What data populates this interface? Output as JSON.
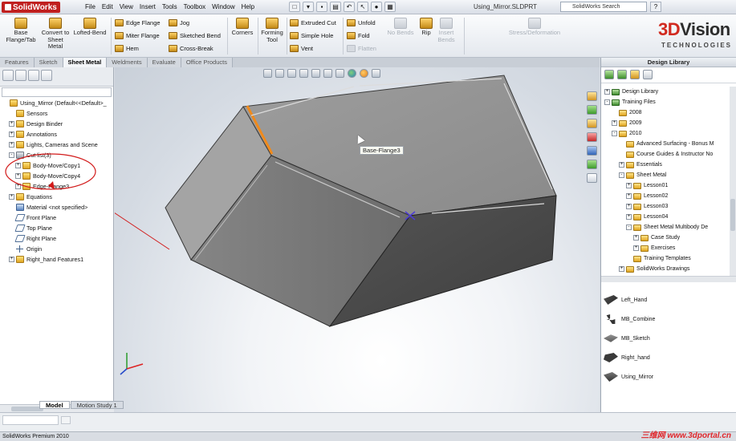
{
  "app": {
    "logo_text": "SolidWorks",
    "document_title": "Using_Mirror.SLDPRT"
  },
  "menu": [
    "File",
    "Edit",
    "View",
    "Insert",
    "Tools",
    "Toolbox",
    "Window",
    "Help"
  ],
  "search": {
    "value": "SolidWorks Search"
  },
  "help_button": "?",
  "ribbon": {
    "base_flange": "Base Flange/Tab",
    "convert": "Convert to Sheet Metal",
    "lofted_bend": "Lofted-Bend",
    "edge_flange": "Edge Flange",
    "miter_flange": "Miter Flange",
    "hem": "Hem",
    "jog": "Jog",
    "sketched_bend": "Sketched Bend",
    "cross_break": "Cross-Break",
    "corners": "Corners",
    "forming_tool": "Forming Tool",
    "extruded_cut": "Extruded Cut",
    "simple_hole": "Simple Hole",
    "vent": "Vent",
    "unfold": "Unfold",
    "fold": "Fold",
    "flatten": "Flatten",
    "no_bends": "No Bends",
    "rip": "Rip",
    "insert_bends": "Insert Bends",
    "shell_deformation": "Stress/Deformation"
  },
  "brand": {
    "main_1": "3D",
    "main_2": "Vision",
    "sub": "TECHNOLOGIES"
  },
  "tabs": [
    "Features",
    "Sketch",
    "Sheet Metal",
    "Weldments",
    "Evaluate",
    "Office Products"
  ],
  "active_tab": "Sheet Metal",
  "feature_tree": [
    {
      "label": "Using_Mirror  (Default<<Default>_",
      "indent": 0,
      "icon": "part-icon",
      "exp": ""
    },
    {
      "label": "Sensors",
      "indent": 1,
      "icon": "sensors-icon",
      "exp": ""
    },
    {
      "label": "Design Binder",
      "indent": 1,
      "icon": "design-binder-icon",
      "exp": "+"
    },
    {
      "label": "Annotations",
      "indent": 1,
      "icon": "annotations-icon",
      "exp": "+"
    },
    {
      "label": "Lights, Cameras and Scene",
      "indent": 1,
      "icon": "lights-icon",
      "exp": "+"
    },
    {
      "label": "Cut list(3)",
      "indent": 1,
      "icon": "cut-list-icon",
      "exp": "-"
    },
    {
      "label": "Body-Move/Copy1",
      "indent": 2,
      "icon": "sheet-body-icon",
      "exp": "+"
    },
    {
      "label": "Body-Move/Copy4",
      "indent": 2,
      "icon": "sheet-body-icon",
      "exp": "+"
    },
    {
      "label": "Edge-Flange3",
      "indent": 2,
      "icon": "sheet-body-icon",
      "exp": "+"
    },
    {
      "label": "Equations",
      "indent": 1,
      "icon": "equations-icon",
      "exp": "+"
    },
    {
      "label": "Material <not specified>",
      "indent": 1,
      "icon": "material-icon",
      "exp": ""
    },
    {
      "label": "Front Plane",
      "indent": 1,
      "icon": "plane-icon",
      "exp": ""
    },
    {
      "label": "Top Plane",
      "indent": 1,
      "icon": "plane-icon",
      "exp": ""
    },
    {
      "label": "Right Plane",
      "indent": 1,
      "icon": "plane-icon",
      "exp": ""
    },
    {
      "label": "Origin",
      "indent": 1,
      "icon": "origin-icon",
      "exp": ""
    },
    {
      "label": "Right_hand Features1",
      "indent": 1,
      "icon": "folder-icon",
      "exp": "+"
    }
  ],
  "graphics": {
    "callout": "Base-Flange3",
    "bottom_tabs": [
      "Model",
      "Motion Study 1"
    ]
  },
  "design_library": {
    "title": "Design Library",
    "tree": [
      {
        "label": "Design Library",
        "indent": 0,
        "exp": "+",
        "kind": "green"
      },
      {
        "label": "Training Files",
        "indent": 0,
        "exp": "-",
        "kind": "green"
      },
      {
        "label": "2008",
        "indent": 1,
        "exp": "",
        "kind": "folder"
      },
      {
        "label": "2009",
        "indent": 1,
        "exp": "+",
        "kind": "folder"
      },
      {
        "label": "2010",
        "indent": 1,
        "exp": "-",
        "kind": "folder"
      },
      {
        "label": "Advanced Surfacing - Bonus M",
        "indent": 2,
        "exp": "",
        "kind": "folder"
      },
      {
        "label": "Course Guides & Instructor No",
        "indent": 2,
        "exp": "",
        "kind": "folder"
      },
      {
        "label": "Essentials",
        "indent": 2,
        "exp": "+",
        "kind": "folder"
      },
      {
        "label": "Sheet Metal",
        "indent": 2,
        "exp": "-",
        "kind": "folder"
      },
      {
        "label": "Lesson01",
        "indent": 3,
        "exp": "+",
        "kind": "folder"
      },
      {
        "label": "Lesson02",
        "indent": 3,
        "exp": "+",
        "kind": "folder"
      },
      {
        "label": "Lesson03",
        "indent": 3,
        "exp": "+",
        "kind": "folder"
      },
      {
        "label": "Lesson04",
        "indent": 3,
        "exp": "+",
        "kind": "folder"
      },
      {
        "label": "Sheet Metal Multibody De",
        "indent": 3,
        "exp": "-",
        "kind": "folder"
      },
      {
        "label": "Case Study",
        "indent": 4,
        "exp": "+",
        "kind": "folder"
      },
      {
        "label": "Exercises",
        "indent": 4,
        "exp": "+",
        "kind": "folder"
      },
      {
        "label": "Training Templates",
        "indent": 3,
        "exp": "",
        "kind": "folder"
      },
      {
        "label": "SolidWorks Drawings",
        "indent": 2,
        "exp": "+",
        "kind": "folder"
      }
    ],
    "files": [
      "Left_Hand",
      "MB_Combine",
      "MB_Sketch",
      "Right_hand",
      "Using_Mirror"
    ]
  },
  "status_bar": "SolidWorks Premium 2010",
  "watermark": "三维网 www.3dportal.cn"
}
